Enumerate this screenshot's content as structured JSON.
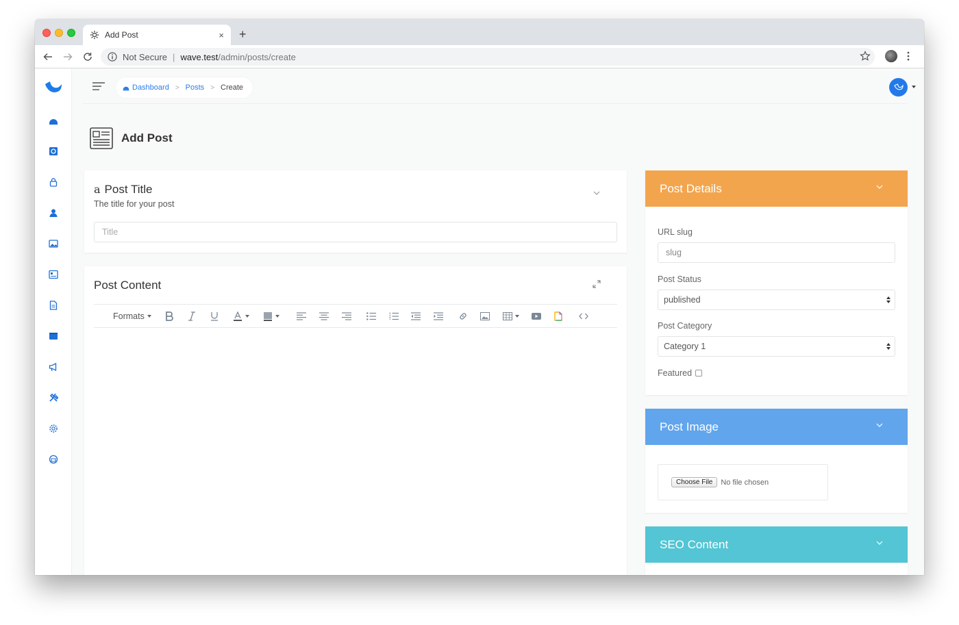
{
  "browser": {
    "tab_title": "Add Post",
    "tab_close": "×",
    "new_tab": "+",
    "not_secure": "Not Secure",
    "url_host": "wave.test",
    "url_path": "/admin/posts/create"
  },
  "sidebar": {
    "items": [
      {
        "name": "dashboard-icon"
      },
      {
        "name": "database-icon"
      },
      {
        "name": "lock-icon"
      },
      {
        "name": "users-icon"
      },
      {
        "name": "media-icon"
      },
      {
        "name": "posts-icon"
      },
      {
        "name": "pages-icon"
      },
      {
        "name": "categories-icon"
      },
      {
        "name": "announcements-icon"
      },
      {
        "name": "tools-icon"
      },
      {
        "name": "settings-icon"
      },
      {
        "name": "themes-icon"
      }
    ]
  },
  "breadcrumb": {
    "dashboard": "Dashboard",
    "posts": "Posts",
    "current": "Create",
    "separator": ">"
  },
  "page": {
    "title": "Add Post"
  },
  "post_title": {
    "icon_glyph": "a͏͏",
    "heading": "Post Title",
    "subheading": "The title for your post",
    "placeholder": "Title"
  },
  "post_content": {
    "heading": "Post Content",
    "formats_label": "Formats"
  },
  "post_details": {
    "heading": "Post Details",
    "slug_label": "URL slug",
    "slug_placeholder": "slug",
    "status_label": "Post Status",
    "status_value": "published",
    "category_label": "Post Category",
    "category_value": "Category 1",
    "featured_label": "Featured"
  },
  "post_image": {
    "heading": "Post Image",
    "choose_file": "Choose File",
    "no_file": "No file chosen"
  },
  "seo": {
    "heading": "SEO Content"
  },
  "colors": {
    "accent": "#2b7ce9",
    "details_header": "#f3a54e",
    "image_header": "#61a5ec",
    "seo_header": "#53c5d4"
  }
}
